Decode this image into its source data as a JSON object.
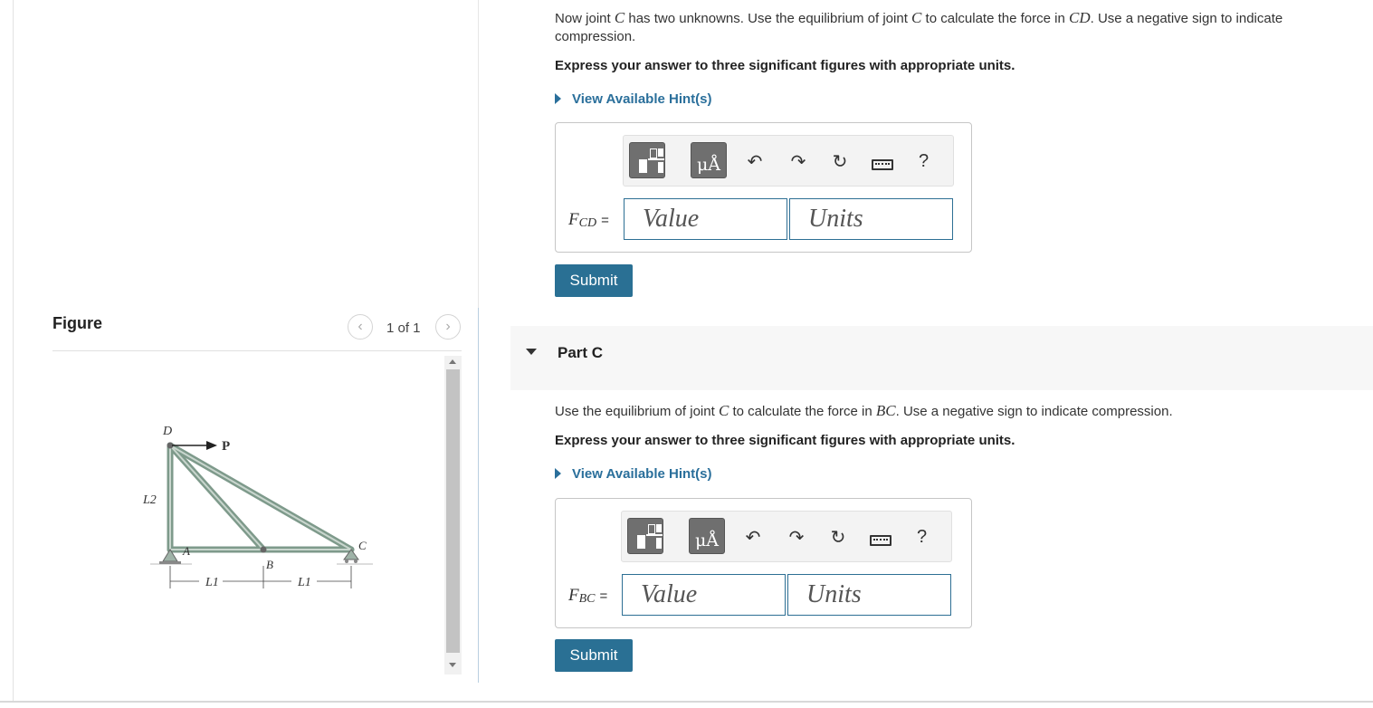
{
  "partB": {
    "prompt_1": "Now joint ",
    "prompt_joint": "C",
    "prompt_2": " has two unknowns. Use the equilibrium of joint ",
    "prompt_joint2": "C",
    "prompt_3": " to calculate the force in ",
    "prompt_member": "CD",
    "prompt_4": ". Use a negative sign to indicate compression.",
    "instruction": "Express your answer to three significant figures with appropriate units.",
    "hint": "View Available Hint(s)",
    "label_main": "F",
    "label_sub": "CD",
    "label_eq": "=",
    "value_placeholder": "Value",
    "units_placeholder": "Units",
    "submit": "Submit"
  },
  "partC": {
    "header": "Part C",
    "prompt_1": "Use the equilibrium of joint ",
    "prompt_joint": "C",
    "prompt_2": " to calculate the force in ",
    "prompt_member": "BC",
    "prompt_3": ". Use a negative sign to indicate compression.",
    "instruction": "Express your answer to three significant figures with appropriate units.",
    "hint": "View Available Hint(s)",
    "label_main": "F",
    "label_sub": "BC",
    "label_eq": "=",
    "value_placeholder": "Value",
    "units_placeholder": "Units",
    "submit": "Submit"
  },
  "toolbar": {
    "units_symbol": "μÅ",
    "help": "?"
  },
  "figure": {
    "title": "Figure",
    "pager": "1 of 1",
    "labels": {
      "D": "D",
      "P": "P",
      "L2": "L2",
      "A": "A",
      "B": "B",
      "C": "C",
      "L1": "L1"
    }
  }
}
